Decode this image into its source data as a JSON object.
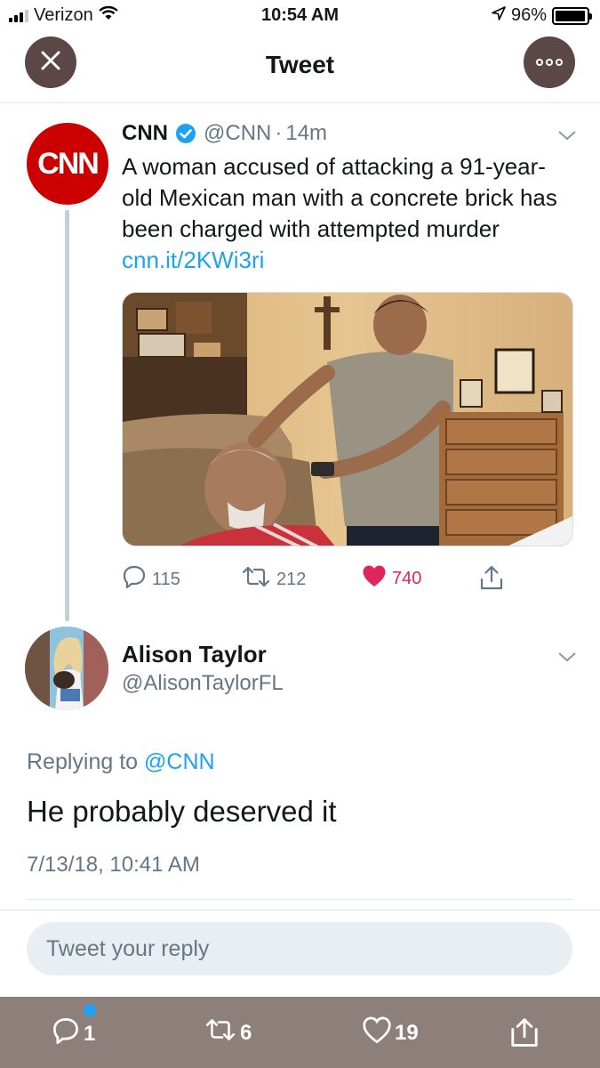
{
  "status_bar": {
    "carrier": "Verizon",
    "time": "10:54 AM",
    "battery": "96%",
    "battery_level": 0.96,
    "icons": [
      "signal-icon",
      "wifi-icon",
      "location-arrow-icon",
      "battery-icon"
    ]
  },
  "nav": {
    "title": "Tweet",
    "close_icon": "close-icon",
    "more_icon": "more-options-icon"
  },
  "tweet": {
    "author_name": "CNN",
    "avatar_text": "CNN",
    "handle": "@CNN",
    "separator": "·",
    "time": "14m",
    "text": "A woman accused of attacking a 91-year-old Mexican man with a concrete brick has been charged with attempted murder",
    "link": "cnn.it/2KWi3ri",
    "media": "photo-of-man-beside-injured-elderly-man",
    "actions": {
      "replies": "115",
      "retweets": "212",
      "likes": "740"
    },
    "colors": {
      "brand": "#cc0000",
      "link": "#1da1f2",
      "like": "#e0245e"
    }
  },
  "reply": {
    "author_name": "Alison Taylor",
    "handle": "@AlisonTaylorFL",
    "replying_label": "Replying to",
    "replying_to": "@CNN",
    "text": "He probably deserved it",
    "timestamp": "7/13/18, 10:41 AM"
  },
  "compose": {
    "placeholder": "Tweet your reply"
  },
  "bottom_bar": {
    "reply_count": "1",
    "retweet_count": "6",
    "like_count": "19"
  }
}
